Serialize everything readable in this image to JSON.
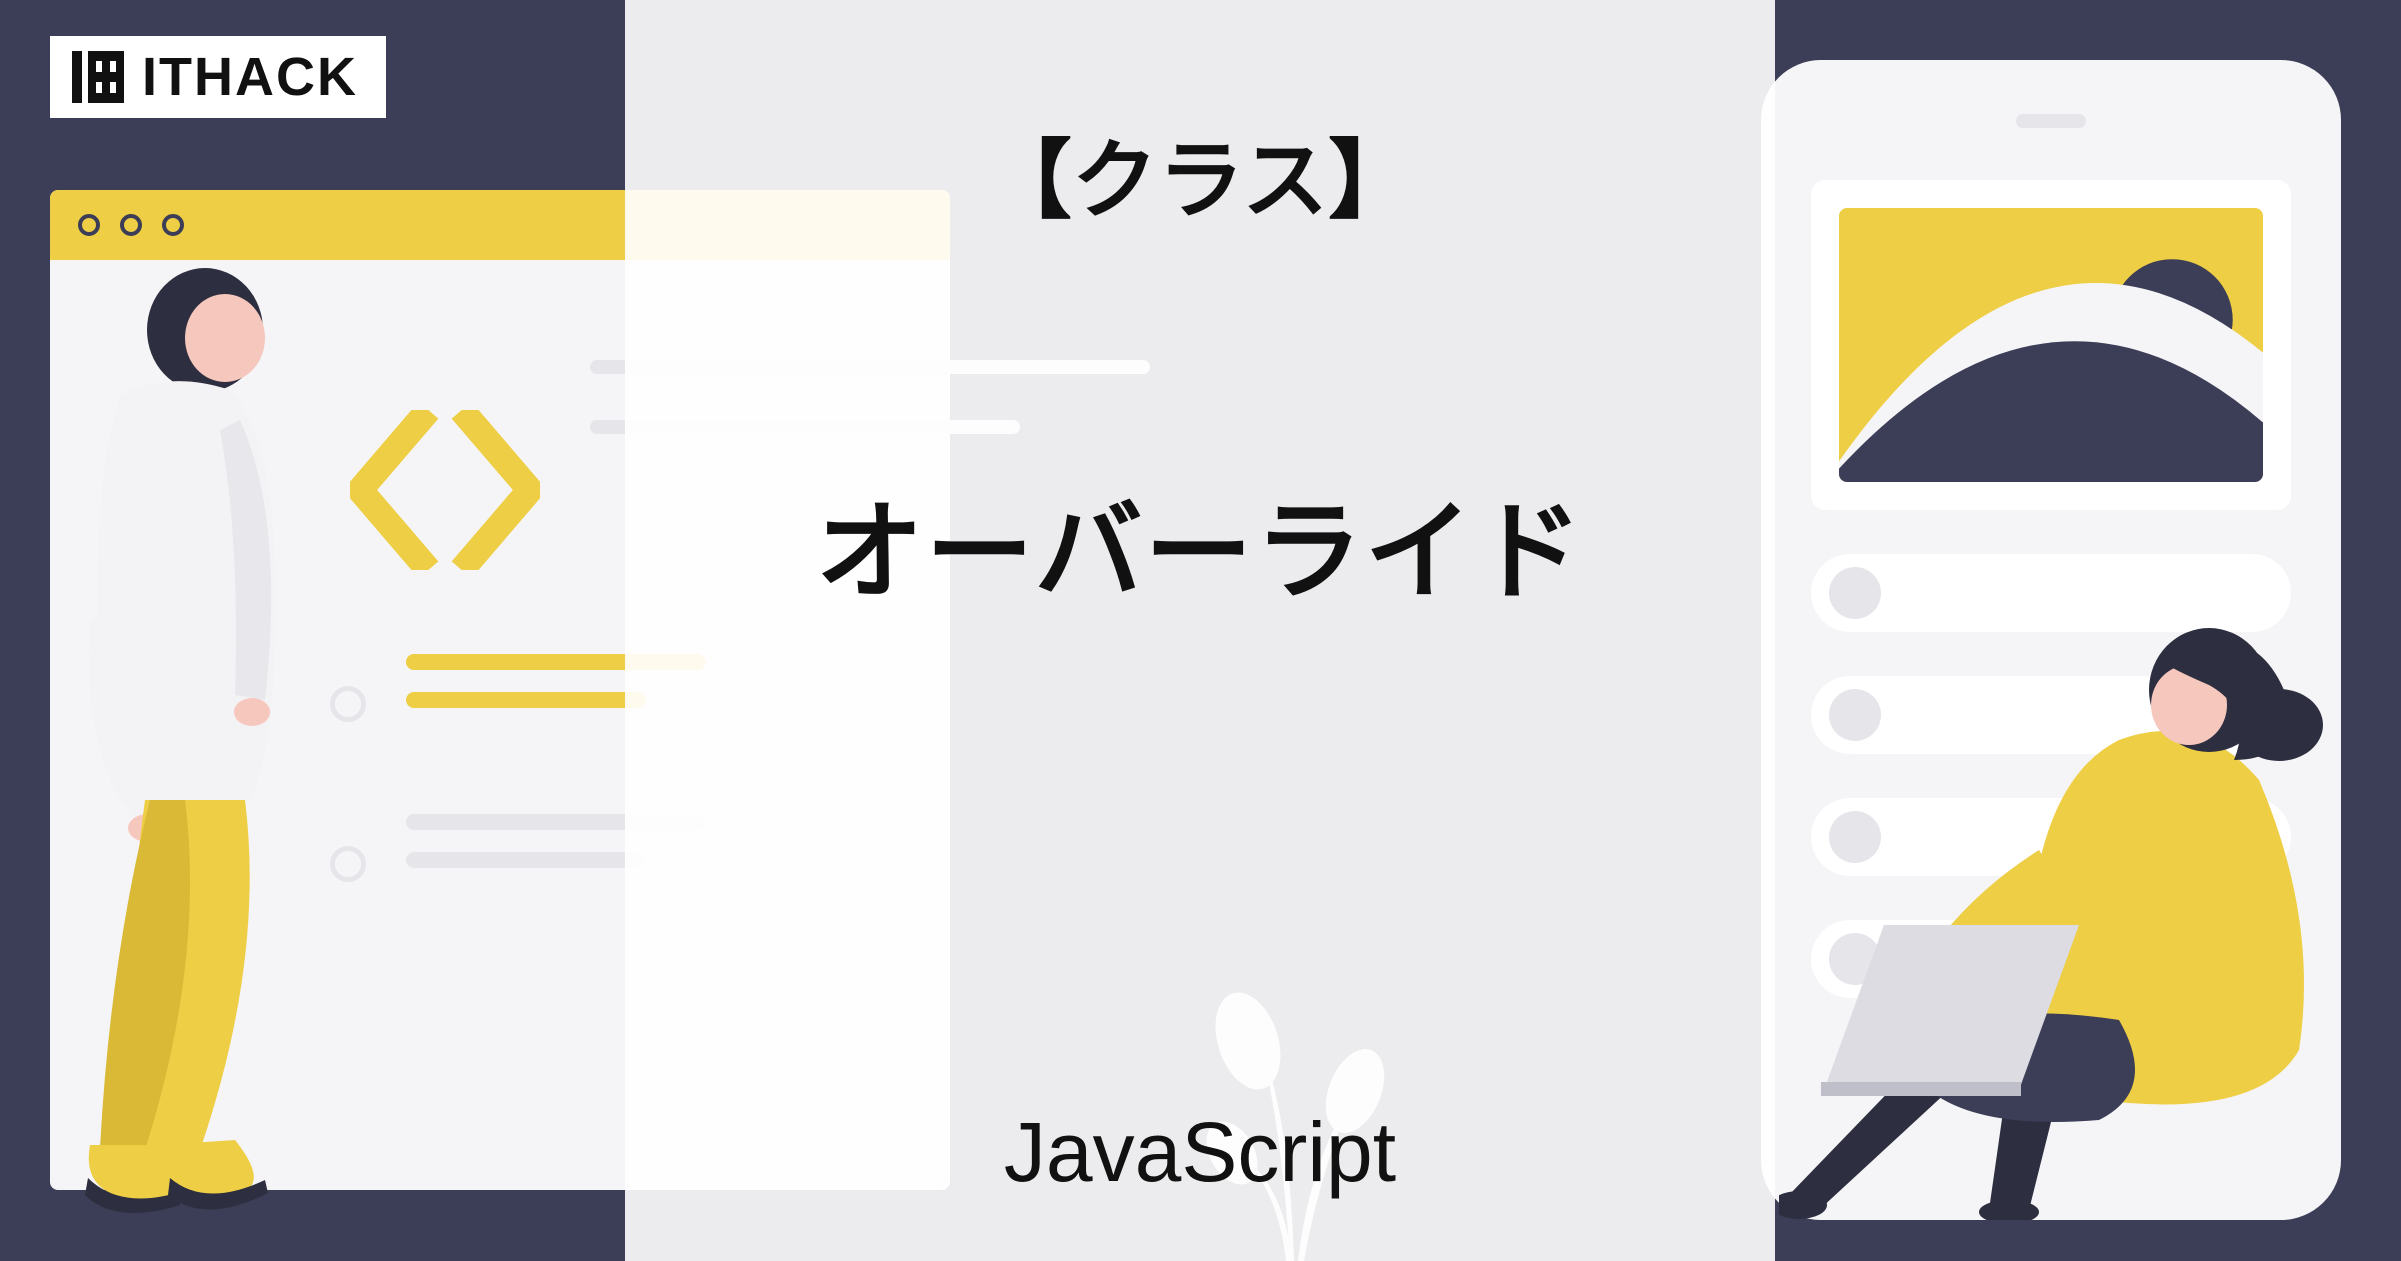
{
  "logo": {
    "text": "ITHACK"
  },
  "card": {
    "subtitle_bracketed": "【クラス】",
    "title": "オーバーライド",
    "footer": "JavaScript"
  },
  "colors": {
    "background": "#3c3d56",
    "accent": "#eece45",
    "panel": "#f5f5f7"
  },
  "icons": {
    "logo": "ithack-logo-icon",
    "code": "angle-brackets-icon"
  }
}
